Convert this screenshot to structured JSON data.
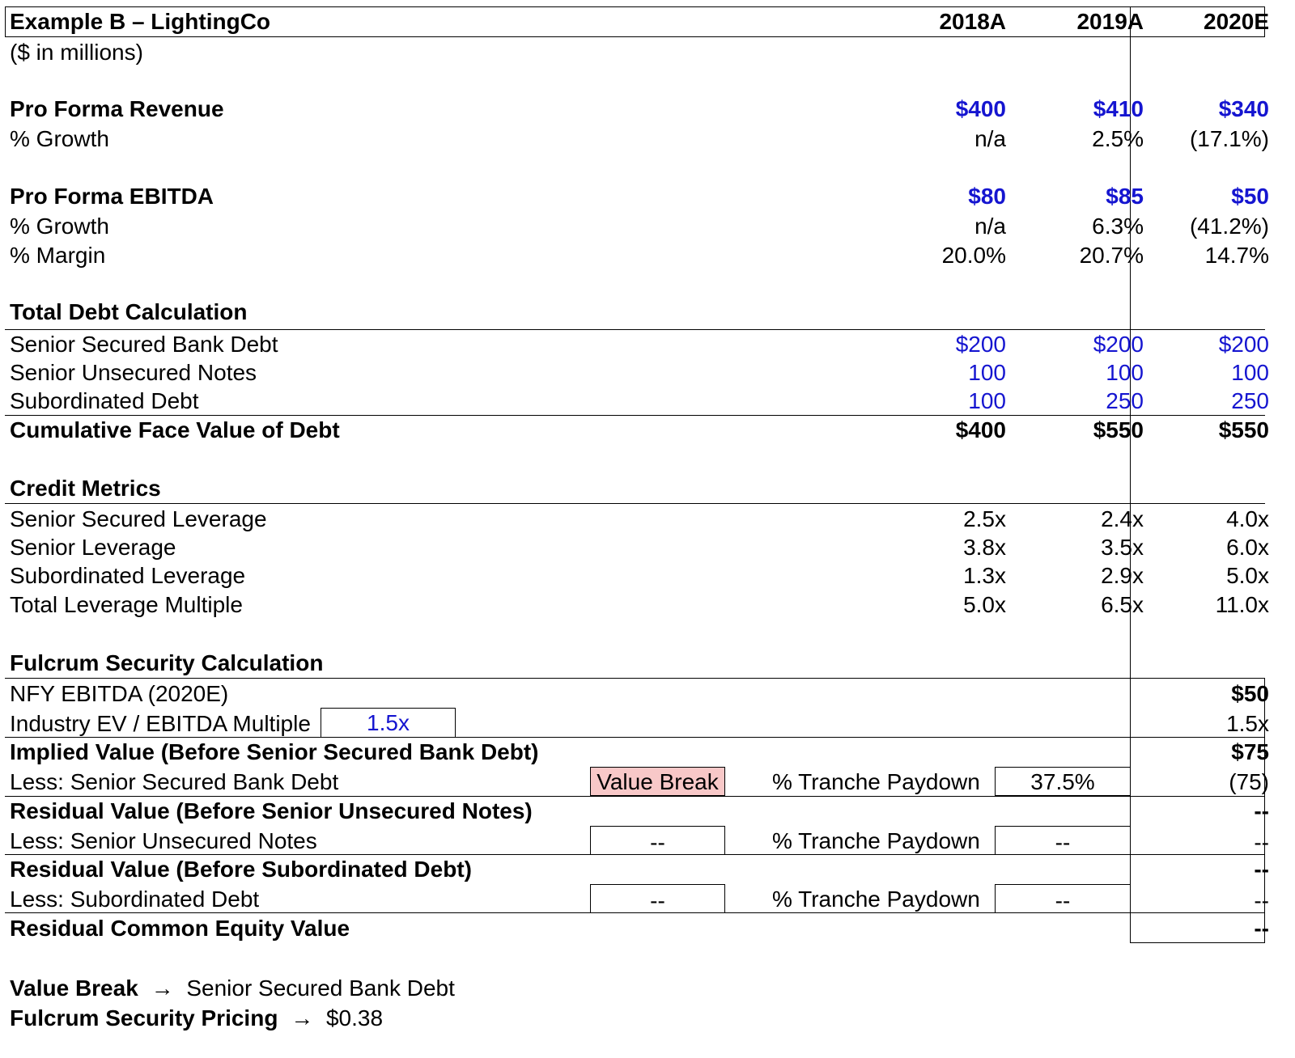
{
  "header": {
    "title": "Example B – LightingCo",
    "units": "($ in millions)",
    "years": [
      "2018A",
      "2019A",
      "2020E"
    ]
  },
  "revenue": {
    "label": "Pro Forma Revenue",
    "values": [
      "$400",
      "$410",
      "$340"
    ],
    "growth_label": "% Growth",
    "growth": [
      "n/a",
      "2.5%",
      "(17.1%)"
    ]
  },
  "ebitda": {
    "label": "Pro Forma EBITDA",
    "values": [
      "$80",
      "$85",
      "$50"
    ],
    "growth_label": "% Growth",
    "growth": [
      "n/a",
      "6.3%",
      "(41.2%)"
    ],
    "margin_label": "% Margin",
    "margin": [
      "20.0%",
      "20.7%",
      "14.7%"
    ]
  },
  "debt": {
    "section": "Total Debt Calculation",
    "rows": [
      {
        "label": "Senior Secured Bank Debt",
        "values": [
          "$200",
          "$200",
          "$200"
        ]
      },
      {
        "label": "Senior Unsecured Notes",
        "values": [
          "100",
          "100",
          "100"
        ]
      },
      {
        "label": "Subordinated Debt",
        "values": [
          "100",
          "250",
          "250"
        ]
      }
    ],
    "total_label": "Cumulative Face Value of Debt",
    "total": [
      "$400",
      "$550",
      "$550"
    ]
  },
  "credit": {
    "section": "Credit Metrics",
    "rows": [
      {
        "label": "Senior Secured Leverage",
        "values": [
          "2.5x",
          "2.4x",
          "4.0x"
        ]
      },
      {
        "label": "Senior Leverage",
        "values": [
          "3.8x",
          "3.5x",
          "6.0x"
        ]
      },
      {
        "label": "Subordinated Leverage",
        "values": [
          "1.3x",
          "2.9x",
          "5.0x"
        ]
      },
      {
        "label": "Total Leverage Multiple",
        "values": [
          "5.0x",
          "6.5x",
          "11.0x"
        ]
      }
    ]
  },
  "fulcrum": {
    "section": "Fulcrum Security Calculation",
    "nfy_label": "NFY EBITDA (2020E)",
    "nfy_value": "$50",
    "multiple_label": "Industry EV / EBITDA Multiple",
    "multiple_input": "1.5x",
    "multiple_value": "1.5x",
    "implied_label": "Implied Value (Before Senior Secured Bank Debt)",
    "implied_value": "$75",
    "tranches": [
      {
        "less_label": "Less: Senior Secured Bank Debt",
        "flag": "Value Break",
        "paydown_label": "% Tranche Paydown",
        "paydown": "37.5%",
        "value": "(75)"
      },
      {
        "less_label": "Less: Senior Unsecured Notes",
        "flag": "--",
        "paydown_label": "% Tranche Paydown",
        "paydown": "--",
        "value": "--"
      },
      {
        "less_label": "Less: Subordinated Debt",
        "flag": "--",
        "paydown_label": "% Tranche Paydown",
        "paydown": "--",
        "value": "--"
      }
    ],
    "residual_unsecured_label": "Residual Value (Before Senior Unsecured Notes)",
    "residual_unsecured_value": "--",
    "residual_sub_label": "Residual Value (Before Subordinated Debt)",
    "residual_sub_value": "--",
    "equity_label": "Residual Common Equity Value",
    "equity_value": "--"
  },
  "summary": {
    "value_break_label": "Value Break",
    "value_break_value": "Senior Secured Bank Debt",
    "pricing_label": "Fulcrum Security Pricing",
    "pricing_value": "$0.38",
    "arrow": "→"
  }
}
